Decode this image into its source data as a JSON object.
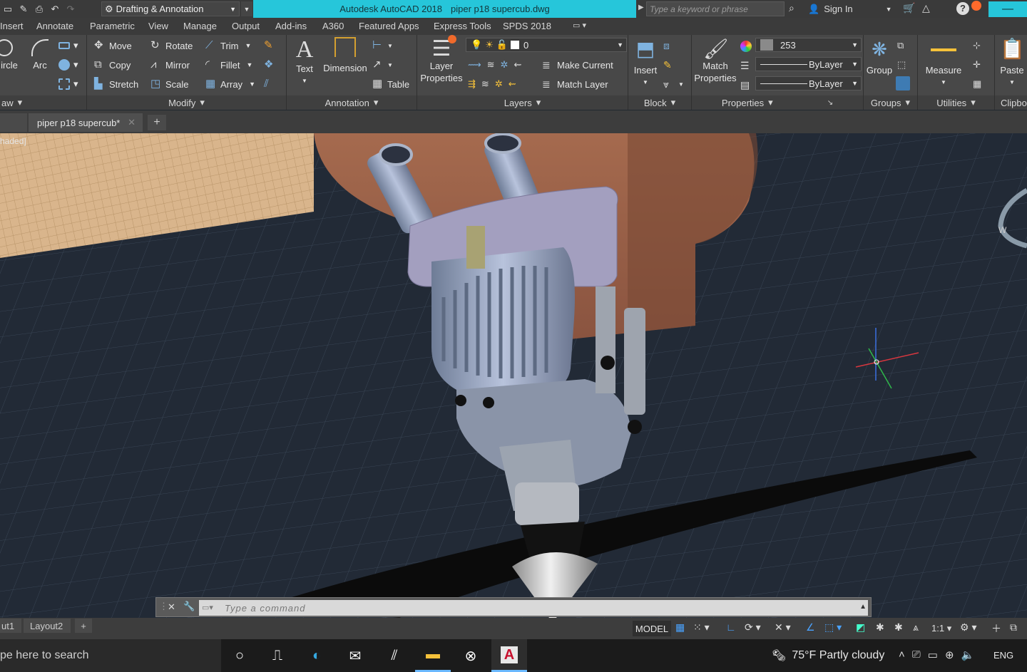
{
  "titlebar": {
    "workspace": "Drafting & Annotation",
    "app": "Autodesk AutoCAD 2018",
    "file": "piper p18 supercub.dwg",
    "search_placeholder": "Type a keyword or phrase",
    "sign_in": "Sign In",
    "accent": "#26c6da"
  },
  "menu_tabs": [
    "Insert",
    "Annotate",
    "Parametric",
    "View",
    "Manage",
    "Output",
    "Add-ins",
    "A360",
    "Featured Apps",
    "Express Tools",
    "SPDS 2018"
  ],
  "ribbon": {
    "draw": {
      "circle": "ircle",
      "arc": "Arc",
      "footer": "aw"
    },
    "modify": {
      "move": "Move",
      "rotate": "Rotate",
      "trim": "Trim",
      "copy": "Copy",
      "mirror": "Mirror",
      "fillet": "Fillet",
      "stretch": "Stretch",
      "scale": "Scale",
      "array": "Array",
      "footer": "Modify"
    },
    "annotation": {
      "text": "Text",
      "dimension": "Dimension",
      "table": "Table",
      "footer": "Annotation"
    },
    "layers": {
      "layer_properties_1": "Layer",
      "layer_properties_2": "Properties",
      "layer_value": "0",
      "make_current": "Make Current",
      "match_layer": "Match Layer",
      "footer": "Layers"
    },
    "block": {
      "insert": "Insert",
      "footer": "Block"
    },
    "properties": {
      "match_1": "Match",
      "match_2": "Properties",
      "color_value": "253",
      "linetype": "ByLayer",
      "lineweight": "ByLayer",
      "footer": "Properties"
    },
    "groups": {
      "group": "Group",
      "footer": "Groups"
    },
    "utilities": {
      "measure": "Measure",
      "footer": "Utilities"
    },
    "clipboard": {
      "paste": "Paste",
      "footer": "Clipbo"
    }
  },
  "document_tab": "piper p18 supercub*",
  "viewport": {
    "label": "haded]"
  },
  "command_line": {
    "placeholder": "Type a command"
  },
  "layout_tabs": [
    "ut1",
    "Layout2"
  ],
  "status": {
    "model": "MODEL",
    "scale": "1:1"
  },
  "taskbar": {
    "search": "pe here to search",
    "weather": "75°F  Partly cloudy",
    "lang": "ENG"
  }
}
